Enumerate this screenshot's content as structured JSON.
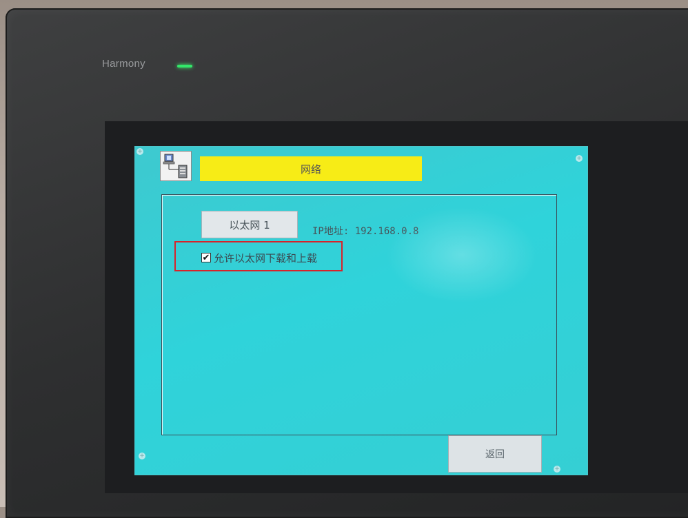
{
  "device": {
    "brand": "Harmony",
    "status_led_color": "#33e86a"
  },
  "screen": {
    "background_color": "#2fd3da",
    "title": "网络",
    "title_bar_color": "#f7ec16",
    "title_icon": "network-computer-icon"
  },
  "network": {
    "ethernet_button_label": "以太网 1",
    "ip_text": "IP地址: 192.168.0.8",
    "allow_download_upload": {
      "label": "允许以太网下载和上载",
      "checked": true
    }
  },
  "annotation": {
    "highlight_color": "#d8232a"
  },
  "footer": {
    "back_label": "返回"
  }
}
